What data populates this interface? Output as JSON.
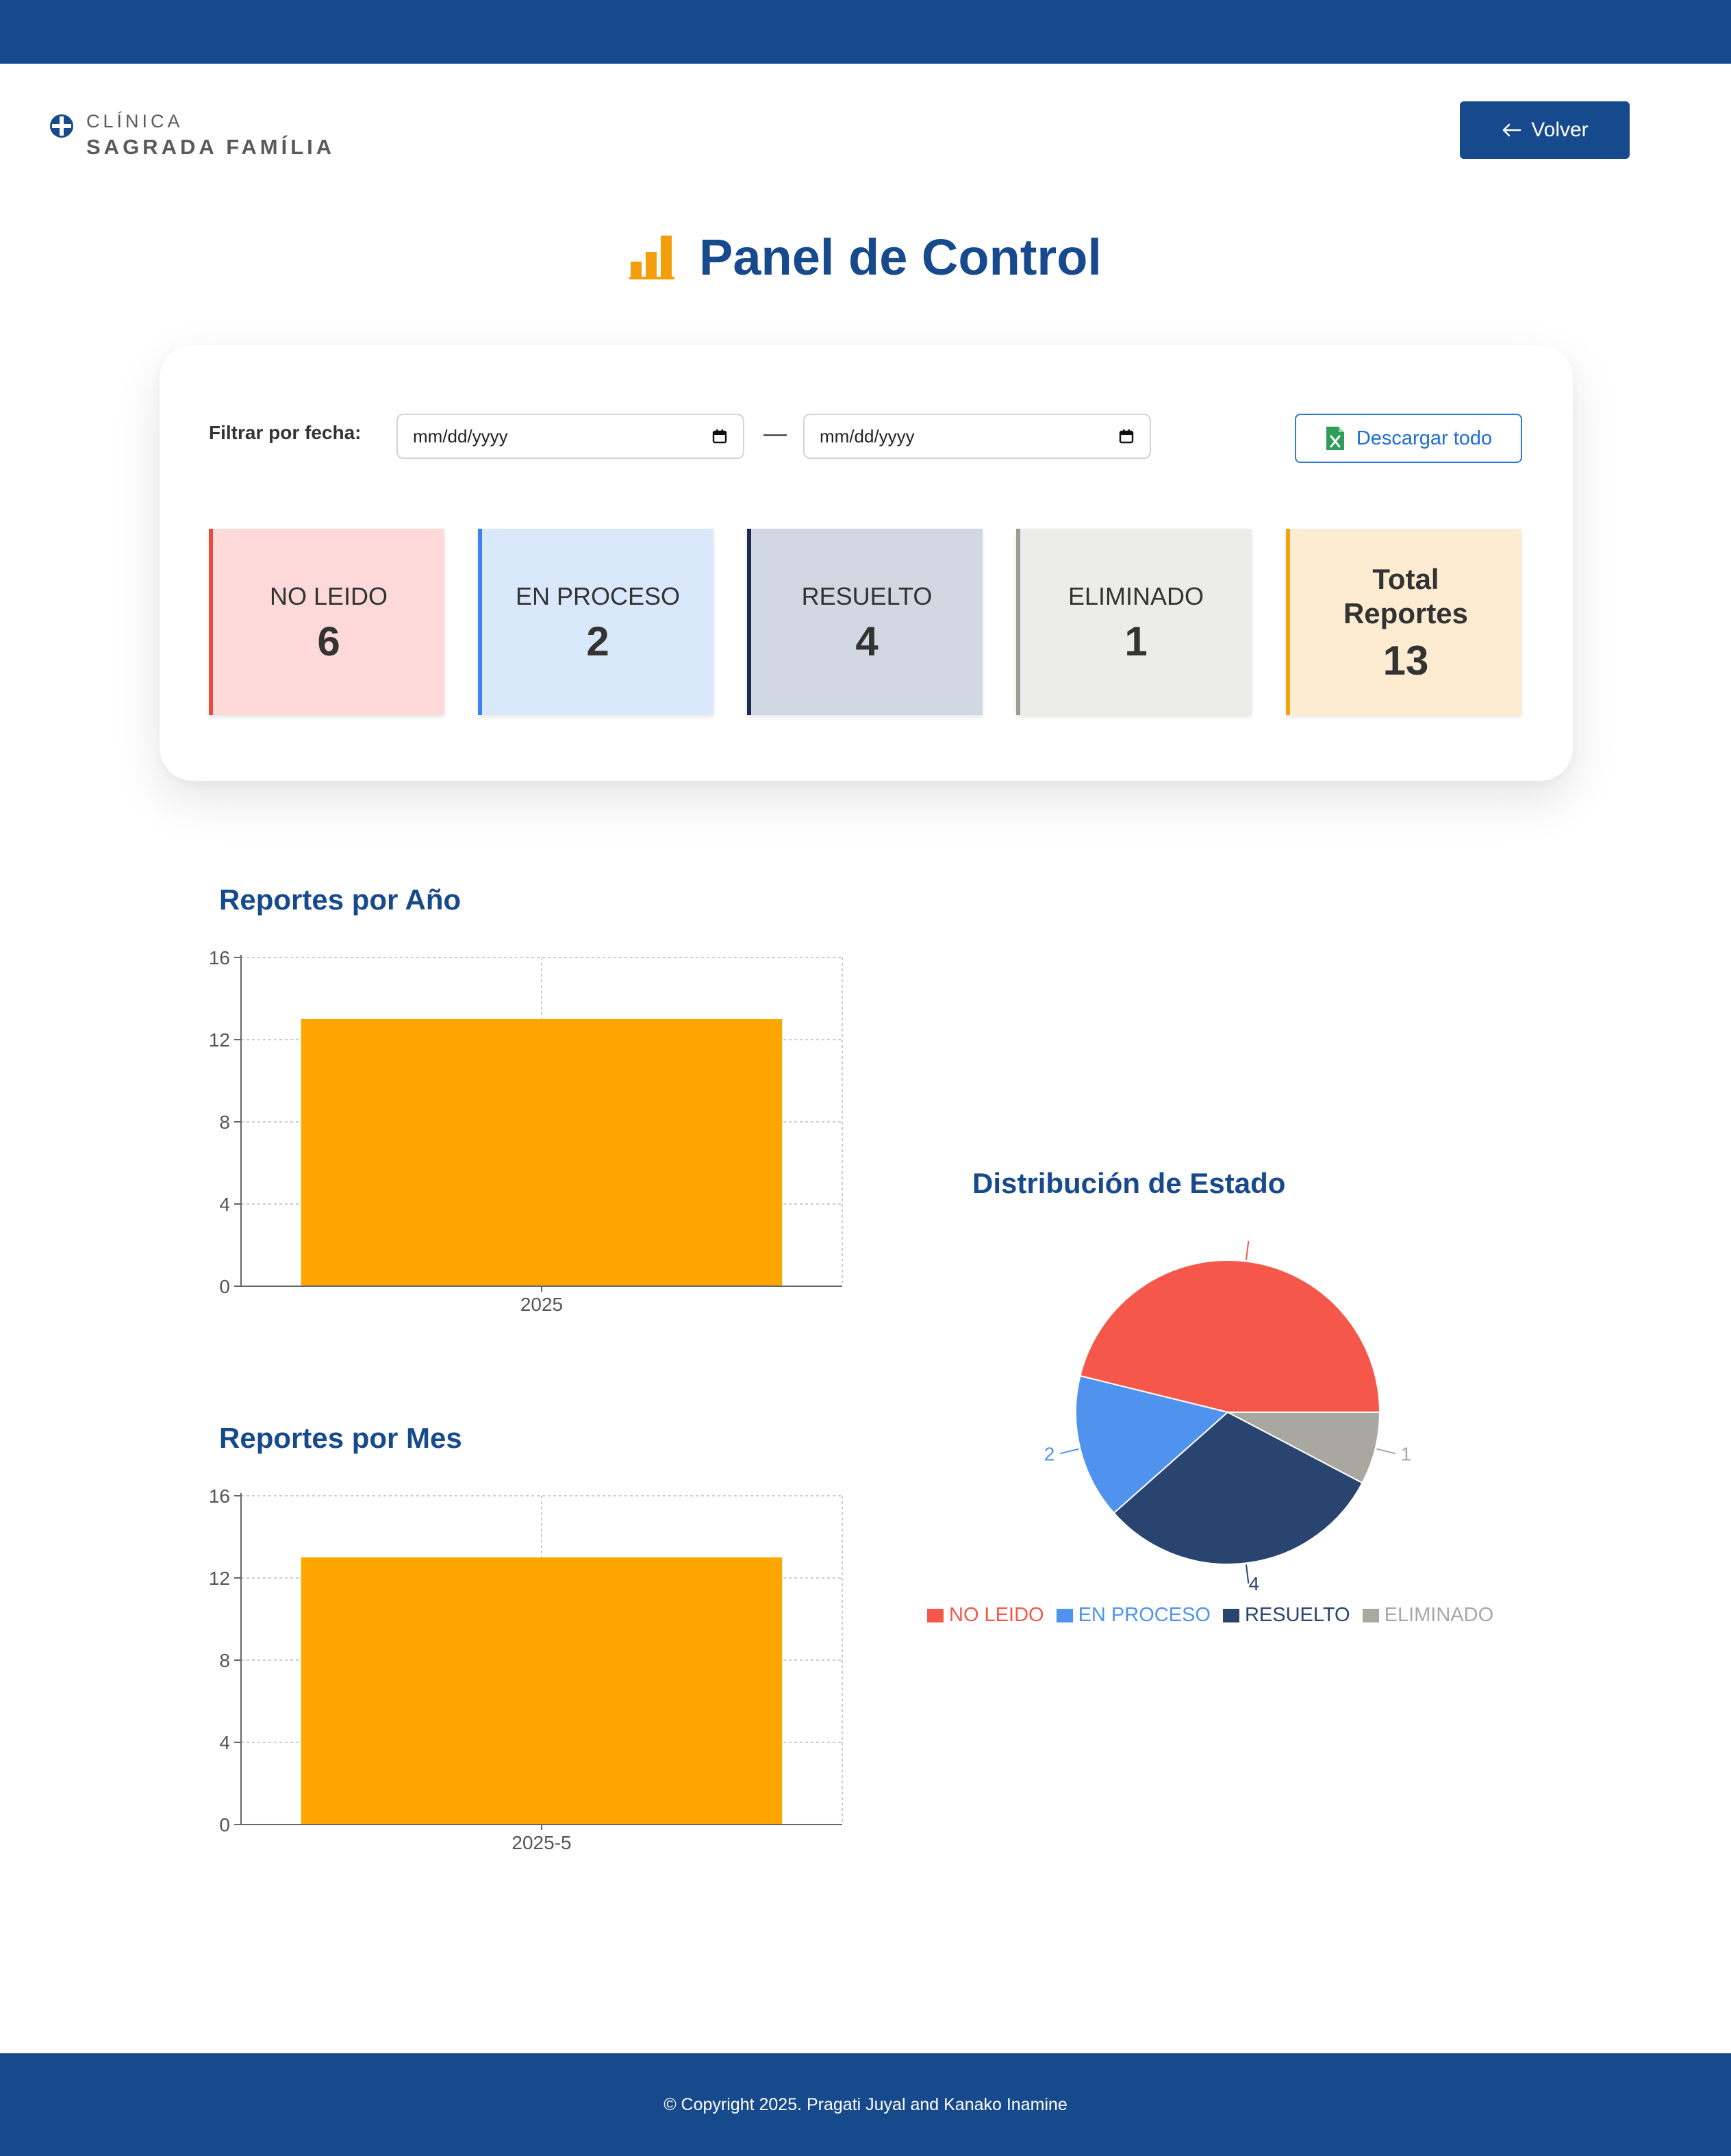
{
  "header": {
    "logo": {
      "line1": "CLÍNICA",
      "line2": "SAGRADA FAMÍLIA"
    },
    "back_button": {
      "label": "Volver",
      "icon": "arrow-left-icon"
    }
  },
  "page": {
    "title": "Panel de Control",
    "title_icon": "bar-chart-icon"
  },
  "filter": {
    "label": "Filtrar por fecha:",
    "date_from": {
      "placeholder": "mm/dd/yyyy",
      "icon": "calendar-icon"
    },
    "separator": "—",
    "date_to": {
      "placeholder": "mm/dd/yyyy",
      "icon": "calendar-icon"
    },
    "download_button": {
      "label": "Descargar todo",
      "icon": "excel-file-icon"
    }
  },
  "stats": [
    {
      "label": "NO LEIDO",
      "value": "6",
      "bg": "#fddad9",
      "border": "#e74c3c"
    },
    {
      "label": "EN PROCESO",
      "value": "2",
      "bg": "#d9e8fb",
      "border": "#3b82f6"
    },
    {
      "label": "RESUELTO",
      "value": "4",
      "bg": "#d2d8e2",
      "border": "#1c2b52"
    },
    {
      "label": "ELIMINADO",
      "value": "1",
      "bg": "#ececea",
      "border": "#9d9d92"
    },
    {
      "label": "Total Reportes",
      "value": "13",
      "bg": "#fdecd1",
      "border": "#f5a212"
    }
  ],
  "sections": {
    "year_title": "Reportes por Año",
    "month_title": "Reportes por Mes",
    "status_title": "Distribución de Estado"
  },
  "chart_data": [
    {
      "id": "year",
      "type": "bar",
      "title": "Reportes por Año",
      "categories": [
        "2025"
      ],
      "values": [
        13
      ],
      "ylim": [
        0,
        16
      ],
      "yticks": [
        0,
        4,
        8,
        12,
        16
      ],
      "grid": true,
      "color": "#ffa500"
    },
    {
      "id": "month",
      "type": "bar",
      "title": "Reportes por Mes",
      "categories": [
        "2025-5"
      ],
      "values": [
        13
      ],
      "ylim": [
        0,
        16
      ],
      "yticks": [
        0,
        4,
        8,
        12,
        16
      ],
      "grid": true,
      "color": "#ffa500"
    },
    {
      "id": "status",
      "type": "pie",
      "title": "Distribución de Estado",
      "categories": [
        "NO LEIDO",
        "EN PROCESO",
        "RESUELTO",
        "ELIMINADO"
      ],
      "values": [
        6,
        2,
        4,
        1
      ],
      "slice_labels": [
        "",
        "2",
        "4",
        "1"
      ],
      "colors": [
        "#f5574b",
        "#4f93ef",
        "#2a4470",
        "#a9a8a0"
      ],
      "legend_position": "bottom"
    }
  ],
  "footer": {
    "text": "© Copyright 2025. Pragati Juyal and Kanako Inamine"
  }
}
